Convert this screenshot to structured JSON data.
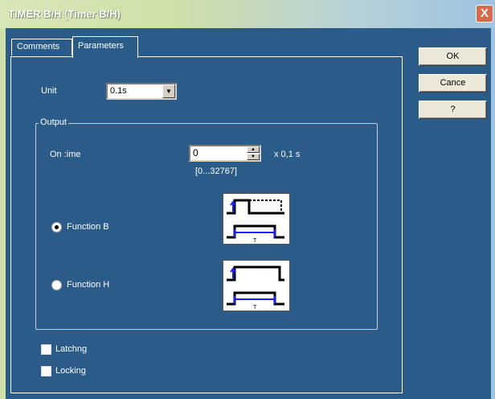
{
  "window": {
    "title": "TIMER B/H (Timer B/H)",
    "close_glyph": "X"
  },
  "tabs": [
    {
      "label": "Comments",
      "active": false
    },
    {
      "label": "Parameters",
      "active": true
    }
  ],
  "buttons": {
    "ok": "OK",
    "cancel": "Cance",
    "help": "?"
  },
  "unit": {
    "label": "Unit",
    "value": "0.1s"
  },
  "output": {
    "legend": "Output",
    "on_time": {
      "label": "On :ime",
      "value": "0",
      "unit": "x 0,1 s",
      "range": "[0...32767]"
    },
    "functions": [
      {
        "label": "Function B",
        "selected": true,
        "icon": "function-b-timing-diagram"
      },
      {
        "label": "Function H",
        "selected": false,
        "icon": "function-h-timing-diagram"
      }
    ]
  },
  "options": [
    {
      "label": "Latchng",
      "checked": false
    },
    {
      "label": "Locking",
      "checked": false
    }
  ],
  "colors": {
    "background": "#2b5b88",
    "title_gradient_start": "#d9e7b8",
    "diagram_accent": "#1a1aff"
  }
}
